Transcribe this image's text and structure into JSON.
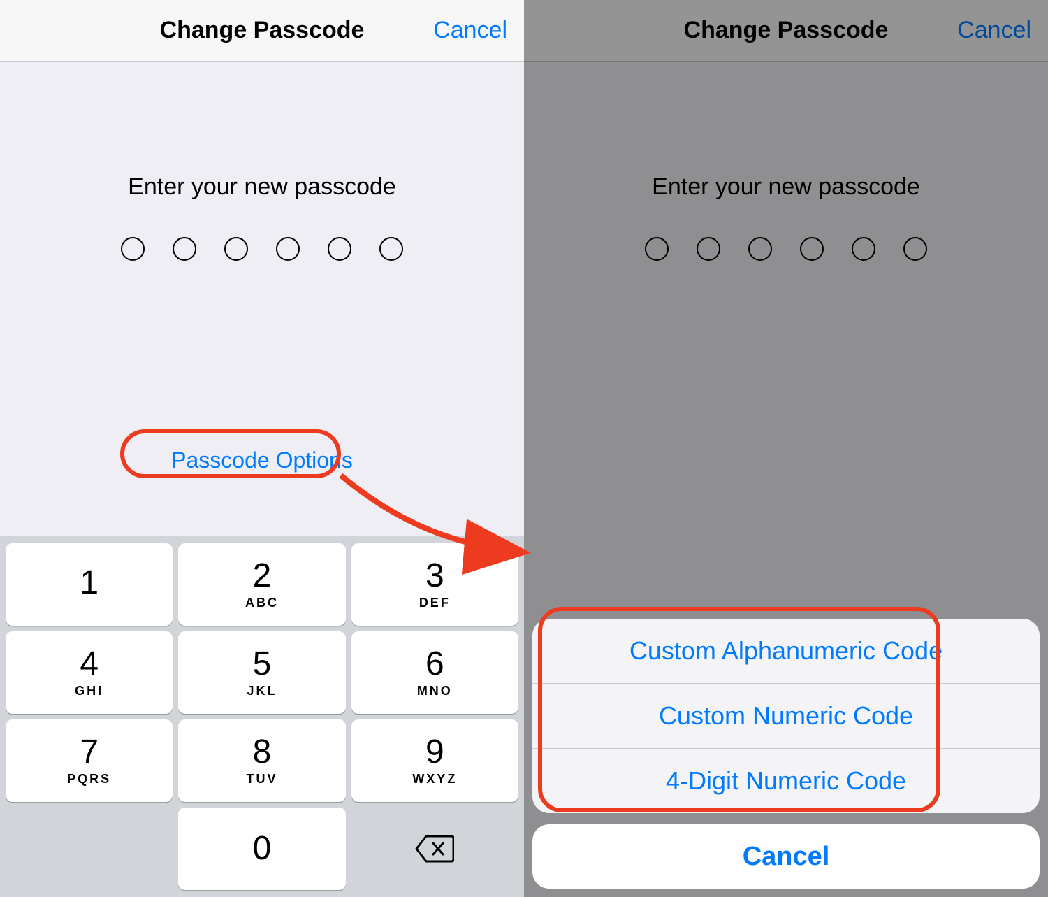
{
  "left": {
    "nav": {
      "title": "Change Passcode",
      "cancel": "Cancel"
    },
    "prompt": "Enter your new passcode",
    "passcode_dots": 6,
    "passcode_options_label": "Passcode Options",
    "keypad": {
      "k1": {
        "digit": "1",
        "letters": " "
      },
      "k2": {
        "digit": "2",
        "letters": "ABC"
      },
      "k3": {
        "digit": "3",
        "letters": "DEF"
      },
      "k4": {
        "digit": "4",
        "letters": "GHI"
      },
      "k5": {
        "digit": "5",
        "letters": "JKL"
      },
      "k6": {
        "digit": "6",
        "letters": "MNO"
      },
      "k7": {
        "digit": "7",
        "letters": "PQRS"
      },
      "k8": {
        "digit": "8",
        "letters": "TUV"
      },
      "k9": {
        "digit": "9",
        "letters": "WXYZ"
      },
      "k0": {
        "digit": "0",
        "letters": ""
      }
    }
  },
  "right": {
    "nav": {
      "title": "Change Passcode",
      "cancel": "Cancel"
    },
    "prompt": "Enter your new passcode",
    "passcode_dots": 6,
    "action_sheet": {
      "options": {
        "alphanumeric": "Custom Alphanumeric Code",
        "numeric": "Custom Numeric Code",
        "four_digit": "4-Digit Numeric Code"
      },
      "cancel": "Cancel"
    }
  },
  "annotation": {
    "arrow_color": "#ed3b1f"
  }
}
